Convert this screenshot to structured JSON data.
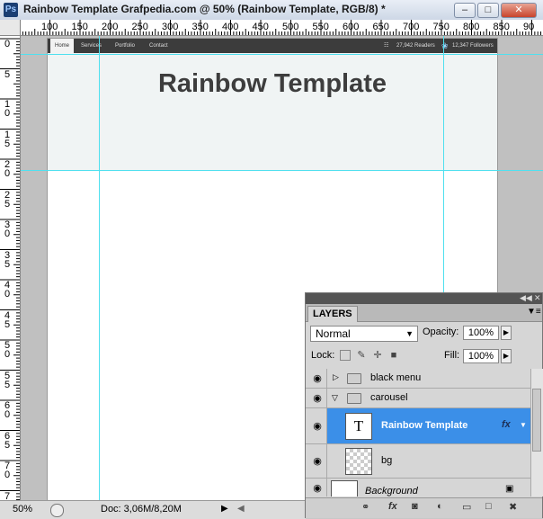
{
  "window": {
    "title": "Rainbow Template Grafpedia.com @ 50% (Rainbow Template, RGB/8) *",
    "app_badge": "Ps",
    "buttons": [
      "–",
      "□",
      "✕"
    ]
  },
  "rulers": {
    "top_labels": [
      "100",
      "150",
      "200",
      "250",
      "300",
      "350",
      "400",
      "450",
      "500",
      "550",
      "600",
      "650",
      "700",
      "750",
      "800",
      "850",
      "90"
    ],
    "left_labels": [
      "0",
      "5",
      "10",
      "15",
      "20",
      "25",
      "30",
      "35",
      "40",
      "45",
      "50",
      "55",
      "60",
      "65",
      "70",
      "75"
    ]
  },
  "document": {
    "nav": {
      "items": [
        "Home",
        "Services",
        "Portfolio",
        "Contact"
      ],
      "readers": "27,942 Readers",
      "followers": "12,347 Followers"
    },
    "hero_title": "Rainbow Template"
  },
  "status": {
    "zoom": "50%",
    "doc_info": "Doc: 3,06M/8,20M"
  },
  "layers_panel": {
    "tab": "LAYERS",
    "blend_mode": "Normal",
    "opacity_label": "Opacity:",
    "opacity_value": "100%",
    "lock_label": "Lock:",
    "fill_label": "Fill:",
    "fill_value": "100%",
    "layers": [
      {
        "name": "black menu",
        "type": "group",
        "expanded": false
      },
      {
        "name": "carousel",
        "type": "group",
        "expanded": true
      },
      {
        "name": "Rainbow Template",
        "type": "text",
        "selected": true,
        "thumb": "T",
        "fx": "fx"
      },
      {
        "name": "bg",
        "type": "raster"
      },
      {
        "name": "Background",
        "type": "background"
      }
    ]
  },
  "colors": {
    "selection": "#3b8fe8",
    "guide": "#4fe0ef",
    "nav_bg": "#3c3c3c"
  }
}
